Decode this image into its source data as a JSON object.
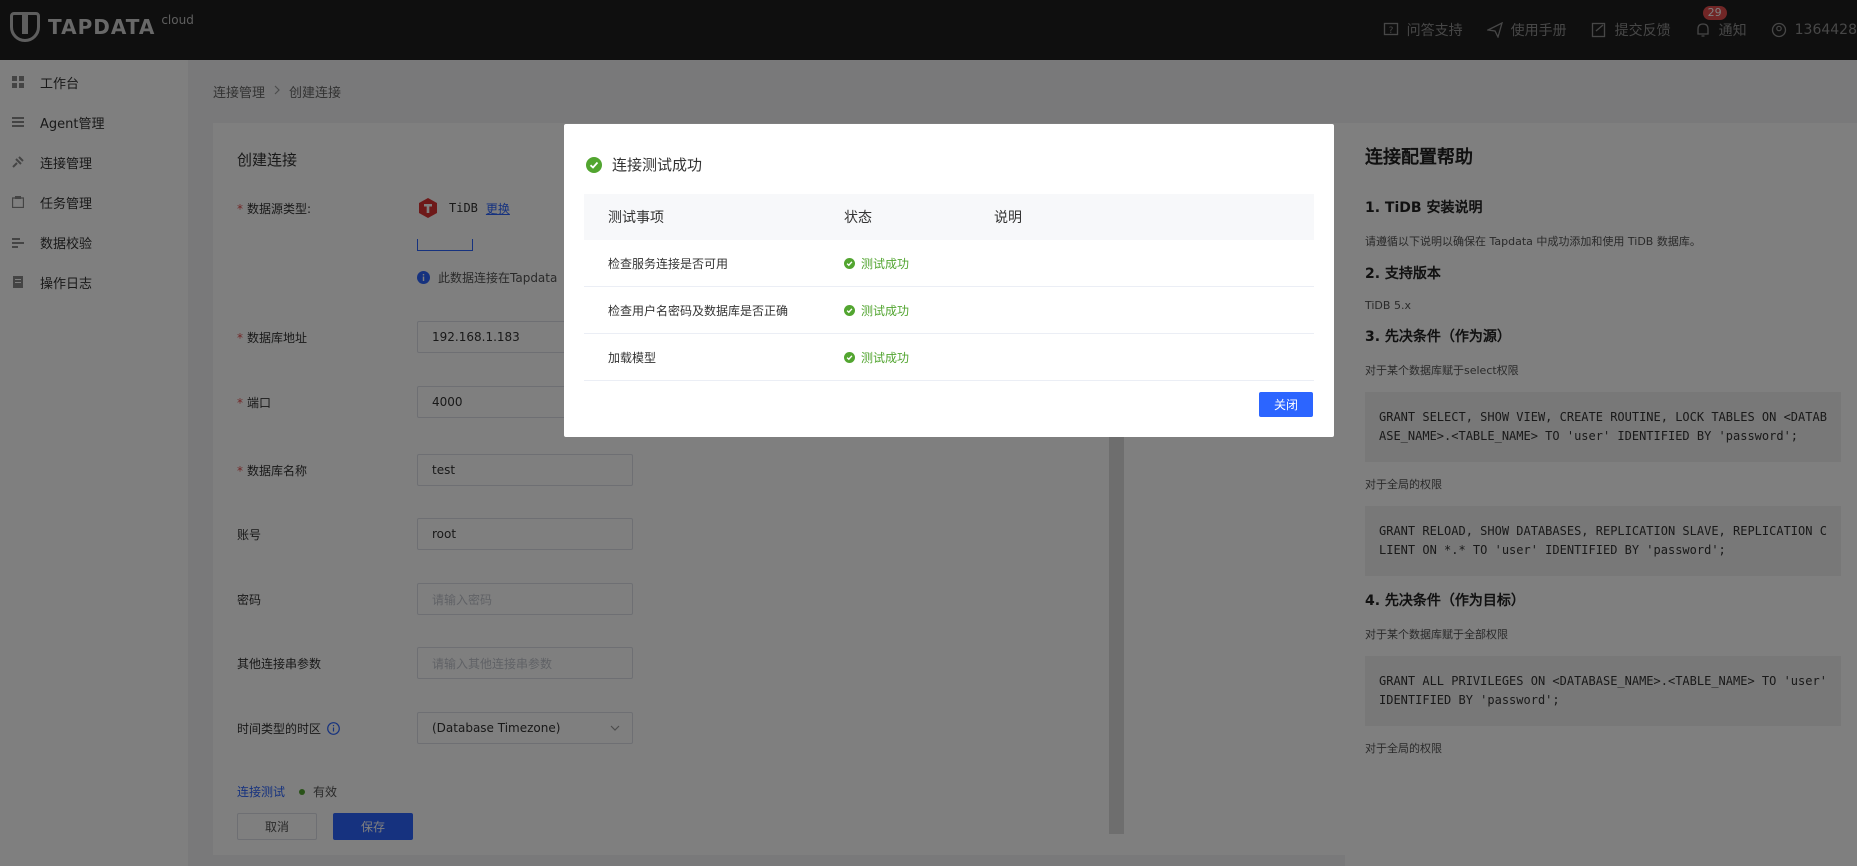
{
  "brand": {
    "name": "TAPDATA",
    "sub": "cloud"
  },
  "topbar": {
    "actions": [
      {
        "label": "问答支持",
        "icon": "question-icon"
      },
      {
        "label": "使用手册",
        "icon": "paper-plane-icon"
      },
      {
        "label": "提交反馈",
        "icon": "feedback-icon"
      },
      {
        "label": "通知",
        "icon": "bell-icon",
        "badge": "29"
      },
      {
        "label": "1364428",
        "icon": "user-icon"
      }
    ]
  },
  "sidebar": {
    "items": [
      {
        "label": "工作台",
        "icon": "dashboard-icon"
      },
      {
        "label": "Agent管理",
        "icon": "list-icon"
      },
      {
        "label": "连接管理",
        "icon": "link-icon"
      },
      {
        "label": "任务管理",
        "icon": "task-icon"
      },
      {
        "label": "数据校验",
        "icon": "verify-icon"
      },
      {
        "label": "操作日志",
        "icon": "log-icon"
      }
    ]
  },
  "breadcrumb": {
    "parent": "连接管理",
    "sep": ">",
    "current": "创建连接"
  },
  "form": {
    "title": "创建连接",
    "datasource_label": "数据源类型:",
    "datasource_name": "TiDB",
    "datasource_change": "更换",
    "datasource_note": "此数据连接在Tapdata",
    "host_label": "数据库地址",
    "host_value": "192.168.1.183",
    "port_label": "端口",
    "port_value": "4000",
    "db_label": "数据库名称",
    "db_value": "test",
    "user_label": "账号",
    "user_value": "root",
    "password_label": "密码",
    "password_placeholder": "请输入密码",
    "params_label": "其他连接串参数",
    "params_placeholder": "请输入其他连接串参数",
    "tz_label": "时间类型的时区",
    "tz_value": "(Database Timezone)",
    "test_link": "连接测试",
    "test_status": "有效",
    "cancel": "取消",
    "save": "保存"
  },
  "help": {
    "title": "连接配置帮助",
    "s1": "1. TiDB 安装说明",
    "s1_text": "请遵循以下说明以确保在 Tapdata 中成功添加和使用 TiDB 数据库。",
    "s2": "2. 支持版本",
    "s2_text": "TiDB 5.x",
    "s3": "3. 先决条件（作为源）",
    "s3_text": "对于某个数据库赋于select权限",
    "s3_code": "GRANT SELECT, SHOW VIEW, CREATE ROUTINE, LOCK TABLES ON <DATABASE_NAME>.<TABLE_NAME> TO 'user' IDENTIFIED BY 'password';",
    "s3_text2": "对于全局的权限",
    "s3_code2": "GRANT RELOAD, SHOW DATABASES, REPLICATION SLAVE, REPLICATION CLIENT ON *.* TO 'user' IDENTIFIED BY 'password';",
    "s4": "4. 先决条件（作为目标）",
    "s4_text": "对于某个数据库赋于全部权限",
    "s4_code": "GRANT ALL PRIVILEGES ON <DATABASE_NAME>.<TABLE_NAME> TO 'user' IDENTIFIED BY 'password';",
    "s4_text2": "对于全局的权限"
  },
  "dialog": {
    "title": "连接测试成功",
    "columns": [
      "测试事项",
      "状态",
      "说明"
    ],
    "rows": [
      {
        "item": "检查服务连接是否可用",
        "status": "测试成功",
        "note": ""
      },
      {
        "item": "检查用户名密码及数据库是否正确",
        "status": "测试成功",
        "note": ""
      },
      {
        "item": "加载模型",
        "status": "测试成功",
        "note": ""
      }
    ],
    "close": "关闭"
  },
  "colors": {
    "accent": "#2c65ff",
    "success": "#52a530",
    "topbar": "#1f1f1f"
  }
}
